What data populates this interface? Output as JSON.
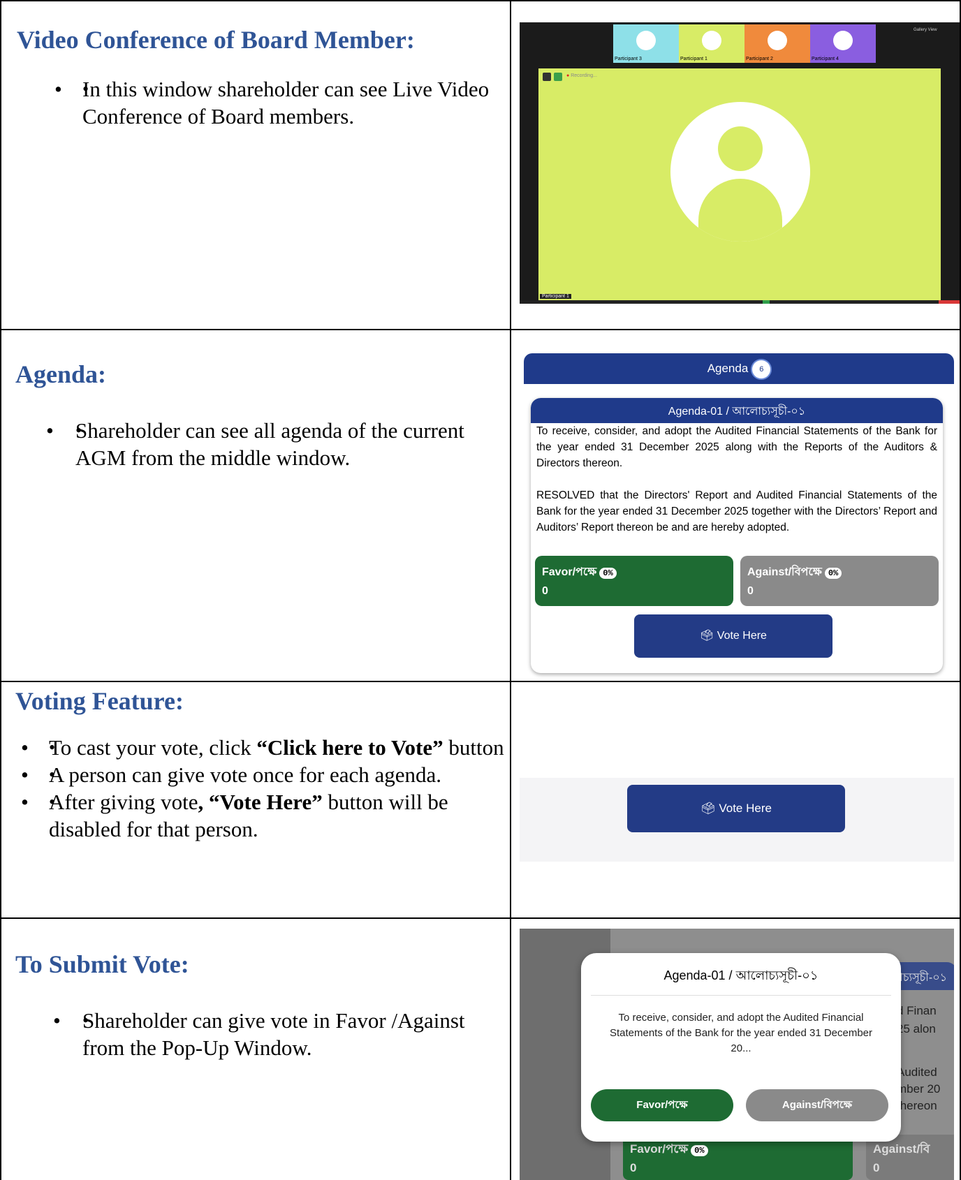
{
  "rows": [
    {
      "title": "Video Conference of Board Member:",
      "bullets": [
        "In this window shareholder can see Live Video Conference of Board members."
      ]
    },
    {
      "title": "Agenda:",
      "bullets": [
        "Shareholder can see all agenda of the current AGM from the middle window."
      ]
    },
    {
      "title": "Voting Feature:",
      "bullets_rich": [
        {
          "pre": "To cast your vote, click ",
          "bold": "“Click here to Vote”",
          "post": " button"
        },
        {
          "pre": "A person can give vote once for each agenda.",
          "bold": "",
          "post": ""
        },
        {
          "pre": "After giving vote",
          "bold": ", “Vote Here”",
          "post": " button will be disabled for that person."
        }
      ]
    },
    {
      "title": "To Submit Vote:",
      "bullets": [
        "Shareholder can give vote in Favor /Against from the Pop-Up Window."
      ]
    }
  ],
  "video": {
    "participants": [
      {
        "label": "Participant 3",
        "color": "#8ee0e8"
      },
      {
        "label": "Participant 1",
        "color": "#d8ec66"
      },
      {
        "label": "Participant 2",
        "color": "#f08a3c"
      },
      {
        "label": "Participant 4",
        "color": "#8a5ee0"
      }
    ],
    "gallery_label": "Gallery View",
    "recording_label": "Recording...",
    "bottom_label": "Participant 1"
  },
  "agenda_panel": {
    "header": "Agenda",
    "count": "6",
    "card_title": "Agenda-01 / আলোচ্যসূচী-০১",
    "para1": "To receive, consider, and adopt the Audited Financial Statements of the Bank for the year ended 31 December 2025 along with the Reports of the Auditors & Directors thereon.",
    "para2": "RESOLVED that the Directors' Report and Audited Financial Statements of the Bank for the year ended 31 December 2025 together with the Directors’ Report and Auditors’ Report thereon be and are hereby adopted.",
    "favor_label": "Favor/পক্ষে",
    "against_label": "Against/বিপক্ষে",
    "favor_pct": "0%",
    "against_pct": "0%",
    "favor_count": "0",
    "against_count": "0",
    "vote_button": "Vote Here"
  },
  "voting_shot": {
    "vote_button": "Vote Here"
  },
  "popup_shot": {
    "bg_title": "Agenda-01 / আলোচ্যসূচী-০১",
    "bg_fragments": [
      "d Finan",
      "25 alon",
      "Audited",
      "mber 20",
      "thereon"
    ],
    "popup_title": "Agenda-01 / আলোচ্যসূচী-০১",
    "popup_body": "To receive, consider, and adopt the Audited Financial Statements of the Bank for the year ended 31 December 20...",
    "favor_button": "Favor/পক্ষে",
    "against_button": "Against/বিপক্ষে",
    "bg_favor": "Favor/পক্ষে",
    "bg_pct": "0%",
    "bg_count": "0",
    "bg_against": "Against/বি",
    "bg_against_count": "0"
  },
  "colors": {
    "heading": "#2f5496",
    "brand_blue": "#1f3a8a",
    "favor_green": "#1e6b33",
    "against_grey": "#8a8a8a"
  }
}
